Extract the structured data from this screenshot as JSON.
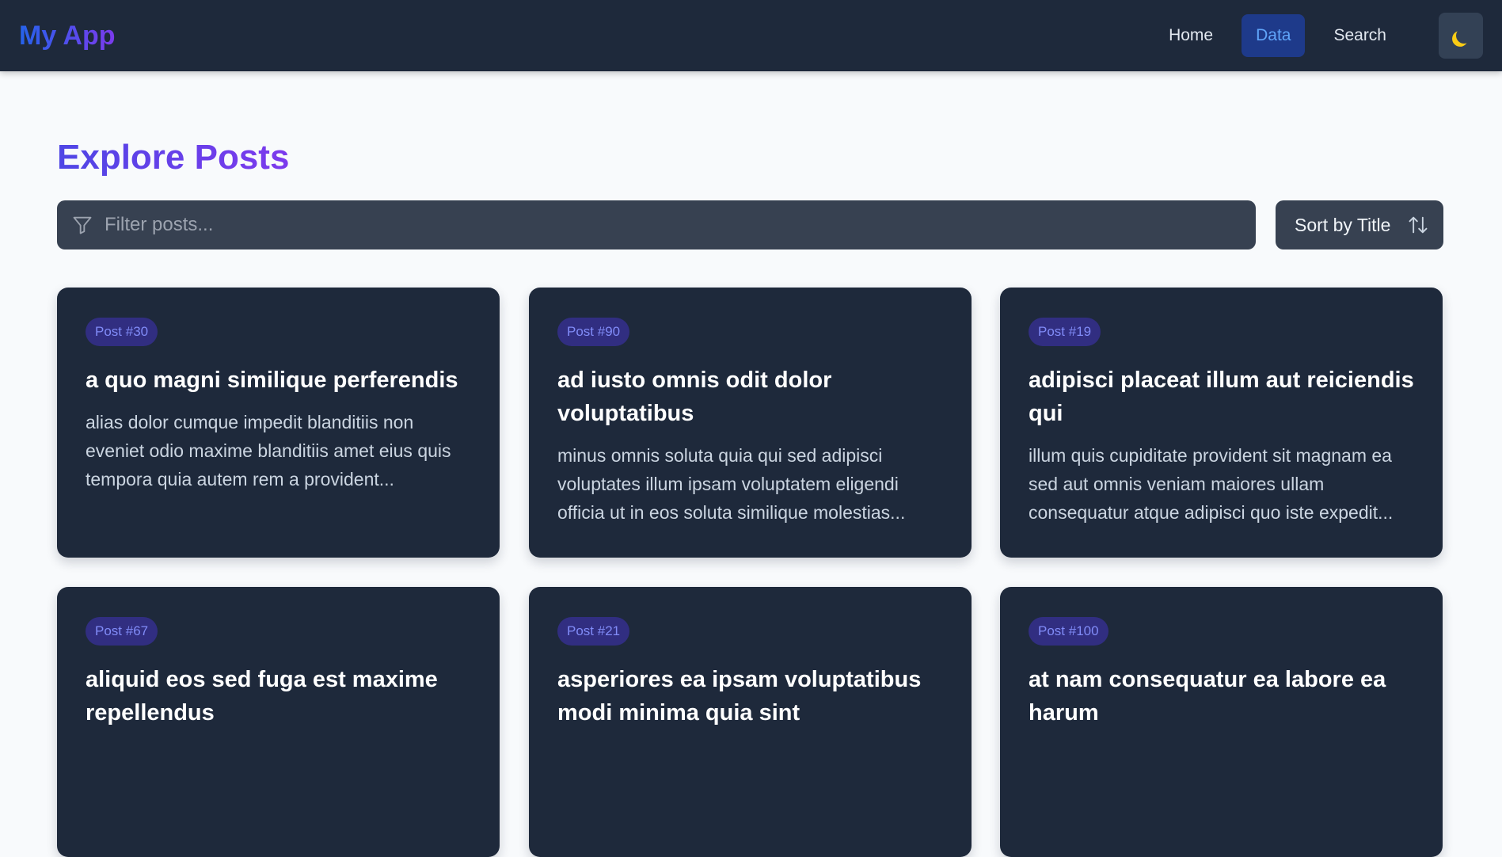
{
  "navbar": {
    "logo": "My App",
    "links": [
      "Home",
      "Data",
      "Search"
    ],
    "active_link": "Data",
    "theme_toggle_icon": "moon-icon"
  },
  "main": {
    "title": "Explore Posts",
    "filter": {
      "placeholder": "Filter posts...",
      "value": ""
    },
    "sort_label": "Sort by Title"
  },
  "posts": [
    {
      "badge": "Post #30",
      "title": "a quo magni similique perferendis",
      "excerpt": "alias dolor cumque impedit blanditiis non eveniet odio maxime blanditiis amet eius quis tempora quia autem rem a provident..."
    },
    {
      "badge": "Post #90",
      "title": "ad iusto omnis odit dolor voluptatibus",
      "excerpt": "minus omnis soluta quia qui sed adipisci voluptates illum ipsam voluptatem eligendi officia ut in eos soluta similique molestias..."
    },
    {
      "badge": "Post #19",
      "title": "adipisci placeat illum aut reiciendis qui",
      "excerpt": "illum quis cupiditate provident sit magnam ea sed aut omnis veniam maiores ullam consequatur atque adipisci quo iste expedit..."
    },
    {
      "badge": "Post #67",
      "title": "aliquid eos sed fuga est maxime repellendus",
      "excerpt": ""
    },
    {
      "badge": "Post #21",
      "title": "asperiores ea ipsam voluptatibus modi minima quia sint",
      "excerpt": ""
    },
    {
      "badge": "Post #100",
      "title": "at nam consequatur ea labore ea harum",
      "excerpt": ""
    }
  ],
  "colors": {
    "navbar_bg": "#1e293b",
    "card_bg": "#1e293b",
    "accent": "#7c3aed",
    "active_link": "#60a5fa"
  }
}
